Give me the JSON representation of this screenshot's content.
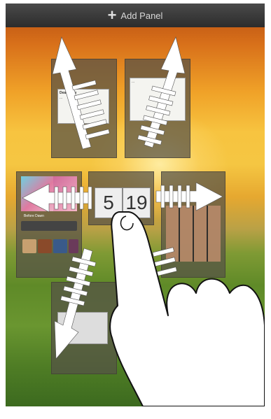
{
  "top_bar": {
    "add_label": "Add Panel",
    "plus_glyph": "+"
  },
  "panels": {
    "top_left": {
      "card_title": "Dear Mom",
      "card_text": "..."
    },
    "top_right": {
      "card_text": "..."
    },
    "center": {
      "clock_hour": "5",
      "clock_minute": "19"
    },
    "left_music": {
      "track": "Before Dawn"
    },
    "bottom_left": {}
  },
  "gesture_icons": [
    "arrow-up-left-icon",
    "arrow-up-right-icon",
    "arrow-left-icon",
    "arrow-right-icon",
    "arrow-down-left-icon",
    "hand-pointer-icon"
  ],
  "colors": {
    "top_bar": "#333333",
    "arrow": "#ffffff",
    "panel": "#5a5448"
  }
}
